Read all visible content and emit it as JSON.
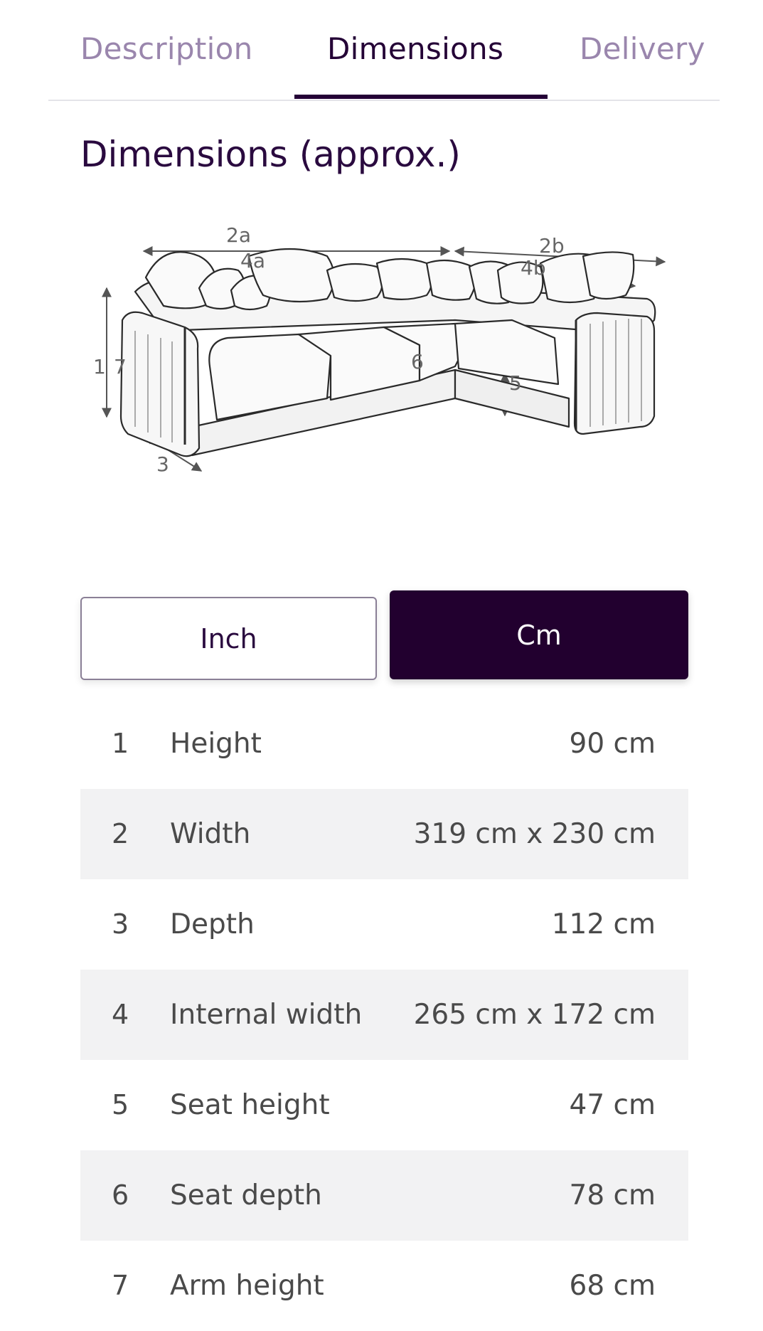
{
  "tabs": [
    {
      "label": "Description",
      "active": false
    },
    {
      "label": "Dimensions",
      "active": true
    },
    {
      "label": "Delivery",
      "active": false
    }
  ],
  "section": {
    "title": "Dimensions (approx.)"
  },
  "diagram": {
    "icon": "corner-sofa-line-drawing",
    "labels": {
      "l2a": "2a",
      "l2b": "2b",
      "l4a": "4a",
      "l4b": "4b",
      "l1": "1",
      "l7": "7",
      "l6": "6",
      "l5": "5",
      "l3": "3"
    }
  },
  "unit_toggle": {
    "options": [
      "Inch",
      "Cm"
    ],
    "selected": "Cm"
  },
  "dimensions": [
    {
      "num": "1",
      "label": "Height",
      "value": "90 cm"
    },
    {
      "num": "2",
      "label": "Width",
      "value": "319 cm x 230 cm"
    },
    {
      "num": "3",
      "label": "Depth",
      "value": "112 cm"
    },
    {
      "num": "4",
      "label": "Internal width",
      "value": "265 cm x 172 cm"
    },
    {
      "num": "5",
      "label": "Seat height",
      "value": "47 cm"
    },
    {
      "num": "6",
      "label": "Seat depth",
      "value": "78 cm"
    },
    {
      "num": "7",
      "label": "Arm height",
      "value": "68 cm"
    }
  ],
  "colors": {
    "brand_dark": "#22002f",
    "tab_inactive": "#9a86ad",
    "row_shade": "#f2f2f3",
    "text_gray": "#4a4a4a"
  }
}
